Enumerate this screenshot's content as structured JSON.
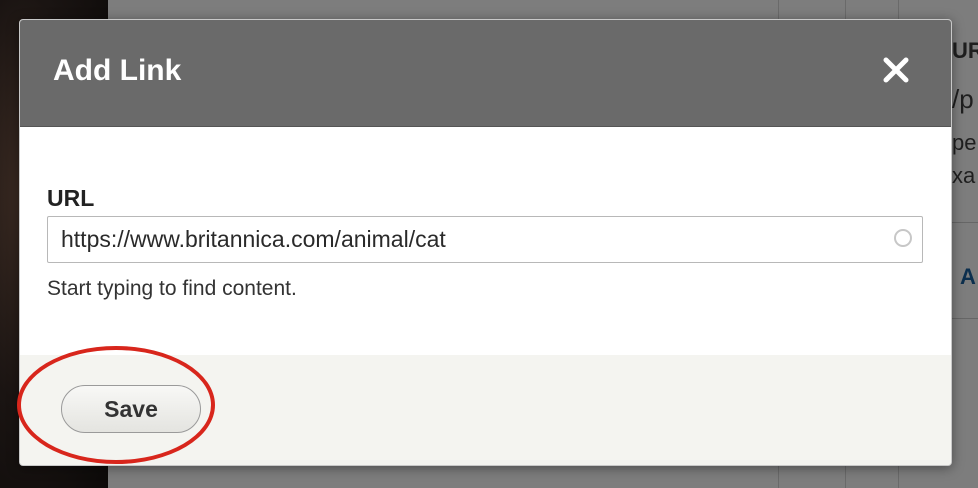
{
  "background": {
    "right_fragments": [
      "UR",
      "/p",
      "pe",
      "xa"
    ],
    "right_link_fragment": "A"
  },
  "dialog": {
    "title": "Add Link",
    "close_icon": "close-icon",
    "url_label": "URL",
    "url_value": "https://www.britannica.com/animal/cat",
    "url_help": "Start typing to find content.",
    "save_label": "Save"
  },
  "colors": {
    "header_bg": "#6a6a6a",
    "footer_bg": "#f4f4f0",
    "highlight": "#d8261c"
  }
}
